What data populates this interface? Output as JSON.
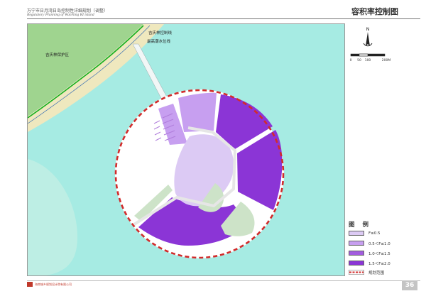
{
  "header": {
    "title_cn": "万宁市日月湾日岛控制性详细规划（调整）",
    "title_en": "Regulatory Planning of WanNing RI island",
    "page_title": "容积率控制图"
  },
  "map": {
    "labels": {
      "reserve": "吉庆林保护区",
      "forest_control_line": "吉庆林控制线",
      "high_tide_line": "最高潮水位线"
    },
    "colors": {
      "sea": "#a6ebe3",
      "land": "#9fd48f",
      "beach": "#efe8be",
      "far_05": "#dccaf4",
      "far_10": "#c79ff0",
      "far_15": "#a25cde",
      "far_20": "#8b35d6",
      "green_space": "#cde3c8",
      "boundary": "#d22b2b"
    }
  },
  "compass": {
    "north_label": "N",
    "icon": "north-arrow-icon"
  },
  "scale_bar": {
    "ticks": [
      "0",
      "50",
      "100",
      "200M"
    ]
  },
  "legend": {
    "title": "图  例",
    "items": [
      {
        "label": "F≤0.5",
        "color": "#dccaf4"
      },
      {
        "label": "0.5＜F≤1.0",
        "color": "#c79ff0"
      },
      {
        "label": "1.0＜F≤1.5",
        "color": "#a25cde"
      },
      {
        "label": "1.5＜F≤2.0",
        "color": "#8b35d6"
      },
      {
        "label": "规划范围",
        "color": "#d22b2b"
      }
    ]
  },
  "footer": {
    "logo_text": "海南城乡规划设计院有限公司",
    "page_number": "36"
  }
}
